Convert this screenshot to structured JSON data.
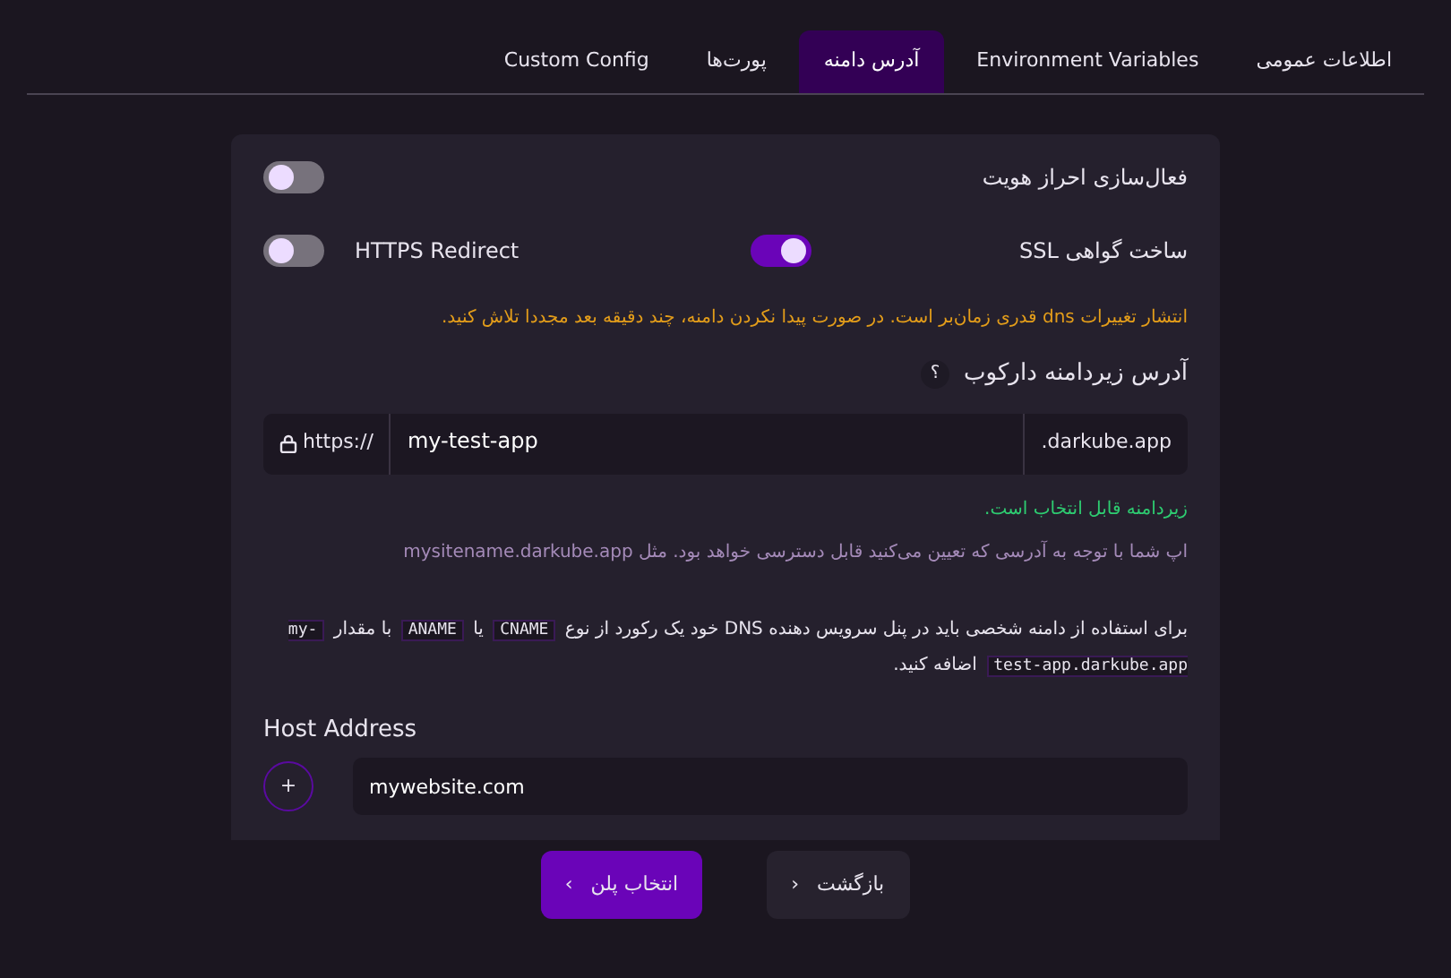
{
  "tabs": [
    {
      "label": "اطلاعات عمومی",
      "selected": false
    },
    {
      "label": "Environment Variables",
      "selected": false
    },
    {
      "label": "آدرس دامنه",
      "selected": true
    },
    {
      "label": "پورت‌ها",
      "selected": false
    },
    {
      "label": "Custom Config",
      "selected": false
    }
  ],
  "auth_toggle": {
    "label": "فعال‌سازی احراز هویت",
    "on": false
  },
  "ssl_toggle": {
    "label": "ساخت گواهی SSL",
    "on": true
  },
  "https_toggle": {
    "label": "HTTPS Redirect",
    "on": false
  },
  "dns_warning": "انتشار تغییرات dns قدری زمان‌بر است. در صورت پیدا نکردن دامنه، چند دقیقه بعد مجددا تلاش کنید.",
  "subdomain": {
    "label": "آدرس زیردامنه دارکوب",
    "help": "؟",
    "prefix": "https://",
    "value": "my-test-app",
    "suffix": ".darkube.app",
    "status": "زیردامنه قابل انتخاب است.",
    "hint": "اپ شما با توجه به آدرسی که تعیین می‌کنید قابل دسترسی خواهد بود. مثل mysitename.darkube.app"
  },
  "dns_instructions": [
    {
      "kind": "text",
      "text": "برای استفاده از دامنه شخصی باید در پنل سرویس دهنده DNS خود یک رکورد از نوع "
    },
    {
      "kind": "code",
      "text": "CNAME"
    },
    {
      "kind": "text",
      "text": " یا "
    },
    {
      "kind": "code",
      "text": "ANAME"
    },
    {
      "kind": "text",
      "text": " با مقدار "
    },
    {
      "kind": "code",
      "text": "my-test-app.darkube.app"
    },
    {
      "kind": "text",
      "text": " اضافه کنید."
    }
  ],
  "host_address": {
    "label": "Host Address",
    "value": "mywebsite.com",
    "add": "+"
  },
  "buttons": {
    "next": "انتخاب پلن",
    "next_icon": "›",
    "back": "بازگشت",
    "back_icon": "‹"
  }
}
